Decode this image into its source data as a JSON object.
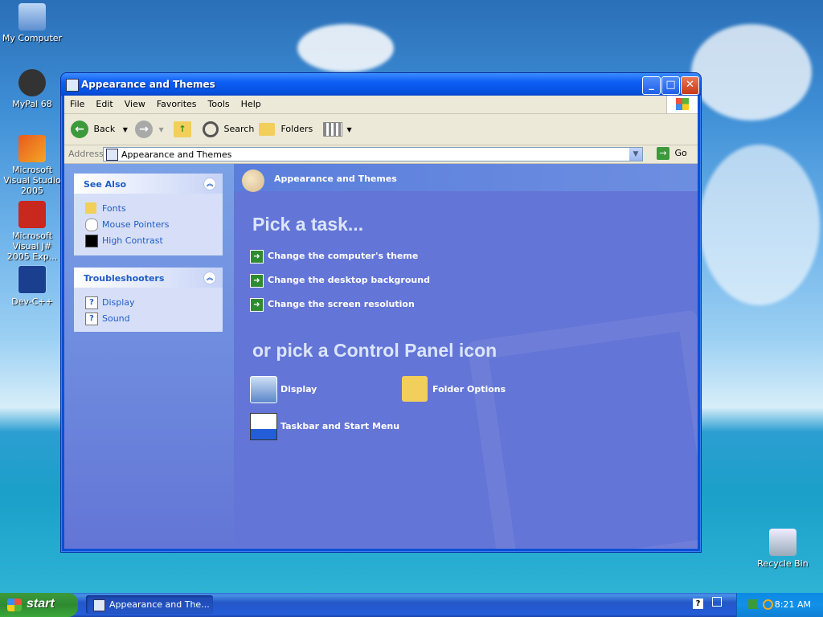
{
  "desktop": {
    "icons": [
      {
        "label": "My Computer"
      },
      {
        "label": "MyPal 68"
      },
      {
        "label": "Microsoft Visual Studio 2005"
      },
      {
        "label": "Microsoft Visual J# 2005 Exp..."
      },
      {
        "label": "Dev-C++"
      },
      {
        "label": "Recycle Bin"
      }
    ]
  },
  "window": {
    "title": "Appearance and Themes",
    "menu": [
      "File",
      "Edit",
      "View",
      "Favorites",
      "Tools",
      "Help"
    ],
    "toolbar": {
      "back": "Back",
      "search": "Search",
      "folders": "Folders"
    },
    "address": {
      "label": "Address",
      "value": "Appearance and Themes",
      "go": "Go"
    },
    "see_also": {
      "title": "See Also",
      "items": [
        {
          "label": "Fonts"
        },
        {
          "label": "Mouse Pointers"
        },
        {
          "label": "High Contrast"
        }
      ]
    },
    "troubleshooters": {
      "title": "Troubleshooters",
      "items": [
        {
          "label": "Display"
        },
        {
          "label": "Sound"
        }
      ]
    },
    "main": {
      "header": "Appearance and Themes",
      "pick_task": "Pick a task...",
      "tasks": [
        {
          "label": "Change the computer's theme"
        },
        {
          "label": "Change the desktop background"
        },
        {
          "label": "Change the screen resolution"
        }
      ],
      "pick_icon": "or pick a Control Panel icon",
      "icons": [
        {
          "label": "Display"
        },
        {
          "label": "Folder Options"
        },
        {
          "label": "Taskbar and Start Menu"
        }
      ]
    }
  },
  "taskbar": {
    "start": "start",
    "item": "Appearance and The...",
    "clock": "8:21 AM"
  }
}
